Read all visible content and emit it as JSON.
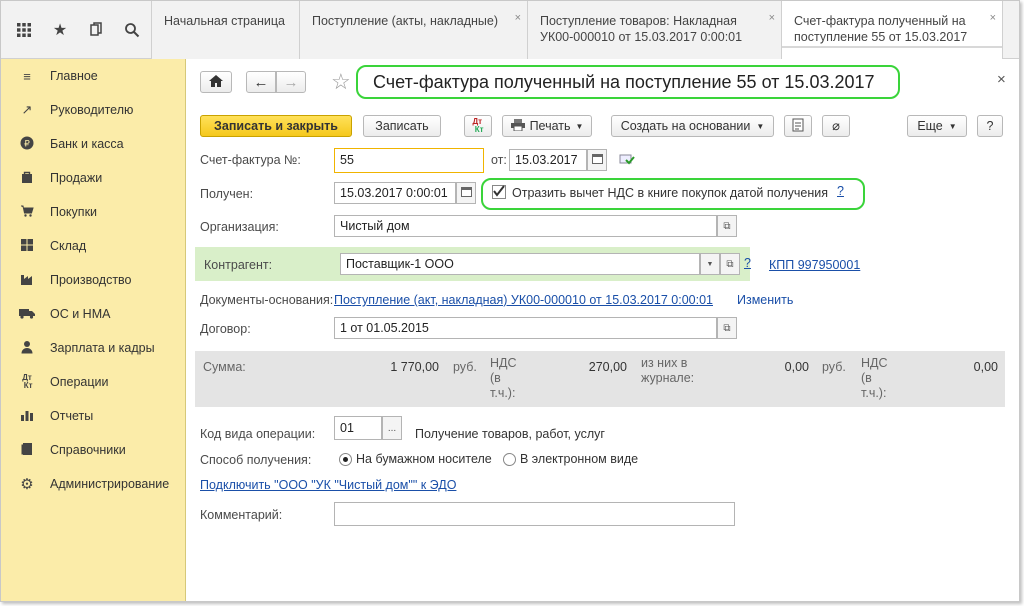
{
  "quick_icons": [
    "apps-grid-icon",
    "star-icon",
    "history-icon",
    "search-icon"
  ],
  "tabs": [
    {
      "label": "Начальная страница"
    },
    {
      "label": "Поступление (акты, накладные)"
    },
    {
      "label": "Поступление товаров: Накладная УК00-000010 от 15.03.2017 0:00:01"
    },
    {
      "label": "Счет-фактура полученный на поступление 55 от 15.03.2017"
    }
  ],
  "sidebar": {
    "items": [
      {
        "label": "Главное",
        "icon": "≡"
      },
      {
        "label": "Руководителю",
        "icon": "↗"
      },
      {
        "label": "Банк и касса",
        "icon": "₽"
      },
      {
        "label": "Продажи",
        "icon": "▮"
      },
      {
        "label": "Покупки",
        "icon": "🛒"
      },
      {
        "label": "Склад",
        "icon": "▦"
      },
      {
        "label": "Производство",
        "icon": "▙"
      },
      {
        "label": "ОС и НМА",
        "icon": "▬"
      },
      {
        "label": "Зарплата и кадры",
        "icon": "👤"
      },
      {
        "label": "Операции",
        "icon": "Дт"
      },
      {
        "label": "Отчеты",
        "icon": "▥"
      },
      {
        "label": "Справочники",
        "icon": "▤"
      },
      {
        "label": "Администрирование",
        "icon": "⚙"
      }
    ]
  },
  "form": {
    "title": "Счет-фактура полученный на поступление 55 от 15.03.2017",
    "close": "×",
    "toolbar": {
      "save_close": "Записать и закрыть",
      "save": "Записать",
      "print": "Печать",
      "create_based": "Создать на основании",
      "more": "Еще",
      "help": "?"
    },
    "invoice_no_label": "Счет-фактура №:",
    "invoice_no": "55",
    "date_from_label": "от:",
    "date": "15.03.2017",
    "received_label": "Получен:",
    "received": "15.03.2017  0:00:01",
    "vat_checkbox_label": "Отразить вычет НДС в книге покупок датой получения",
    "vat_help": "?",
    "org_label": "Организация:",
    "org": "Чистый дом",
    "contractor_label": "Контрагент:",
    "contractor": "Поставщик-1 ООО",
    "kpp_link": "КПП 997950001",
    "docs_label": "Документы-основания:",
    "docs_link": "Поступление (акт, накладная) УК00-000010 от 15.03.2017 0:00:01",
    "change_link": "Изменить",
    "contract_label": "Договор:",
    "contract": "1 от 01.05.2015",
    "totals": {
      "sum_label": "Сумма:",
      "sum": "1 770,00",
      "rub1": "руб.",
      "vat_label": "НДС\n(в\nт.ч.):",
      "vat": "270,00",
      "journal_label": "из них в\nжурнале:",
      "journal": "0,00",
      "rub2": "руб.",
      "vat2_label": "НДС\n(в\nт.ч.):",
      "vat2": "0,00"
    },
    "opcode_label": "Код вида операции:",
    "opcode": "01",
    "opcode_desc": "Получение товаров, работ, услуг",
    "method_label": "Способ получения:",
    "method_paper": "На бумажном носителе",
    "method_electronic": "В электронном виде",
    "edo_link": "Подключить \"ООО \"УК \"Чистый дом\"\" к ЭДО",
    "comment_label": "Комментарий:",
    "comment": ""
  },
  "colors": {
    "sidebar_bg": "#fbeca9",
    "primary_button": "#f5c81c",
    "highlight_outline": "#3ad43a",
    "contractor_row": "#d9efc9",
    "link": "#1a4fa8"
  }
}
